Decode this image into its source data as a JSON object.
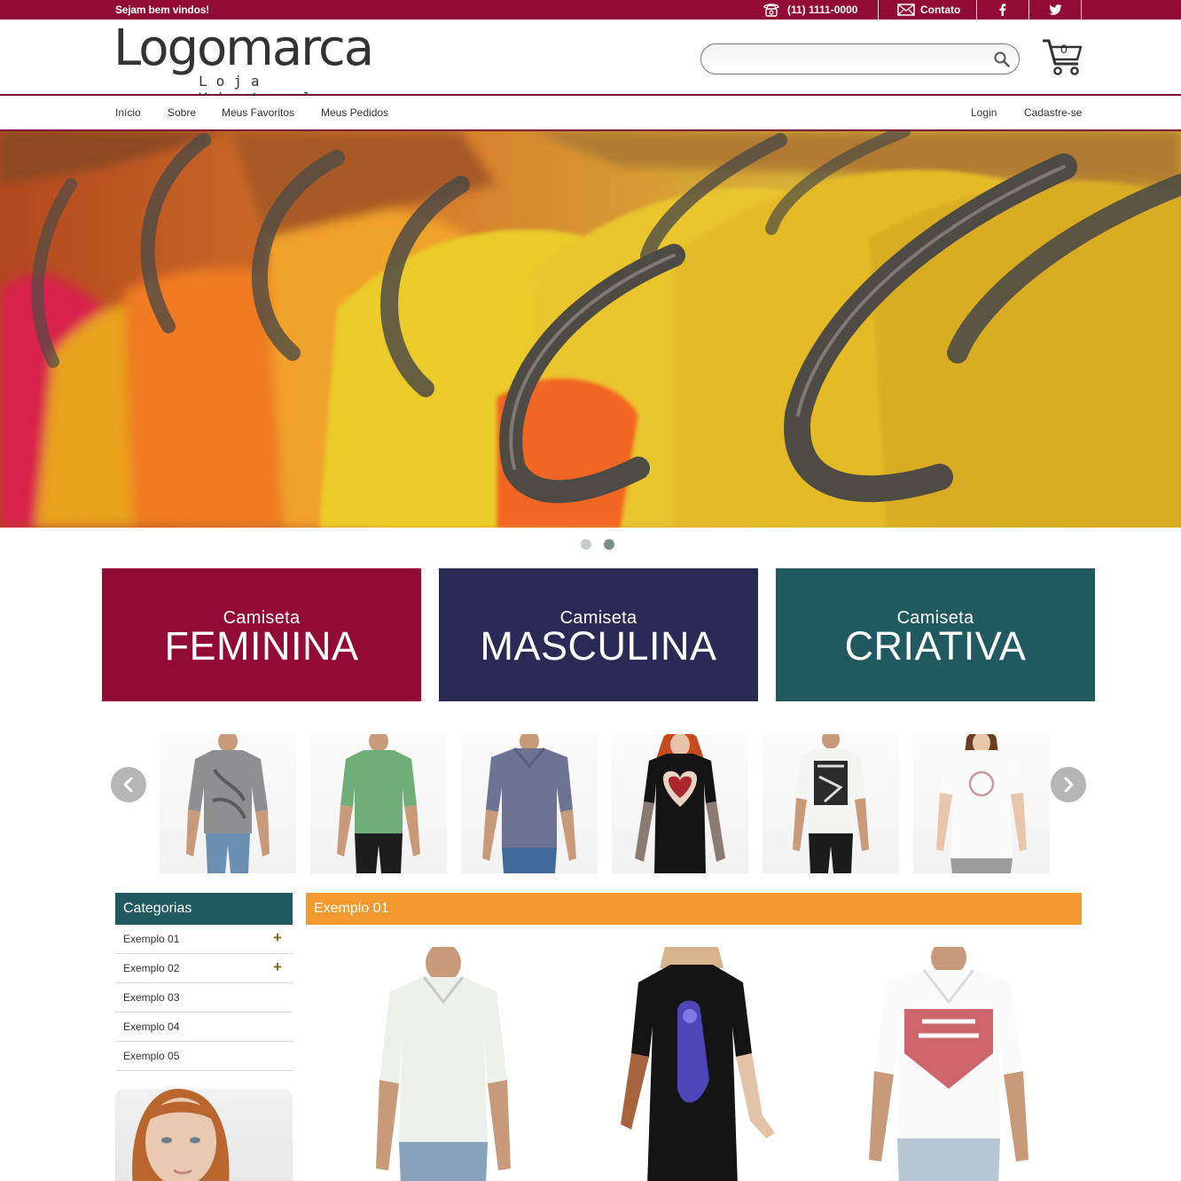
{
  "topbar": {
    "welcome": "Sejam bem vindos!",
    "phone": "(11) 1111-0000",
    "contact_label": "Contato",
    "social": [
      "facebook-icon",
      "twitter-icon"
    ]
  },
  "header": {
    "logo_main": "Logomarca",
    "logo_sub": "Loja Virtual",
    "search_placeholder": "",
    "cart_count": "0"
  },
  "nav": {
    "left": [
      "Início",
      "Sobre",
      "Meus Favoritos",
      "Meus Pedidos"
    ],
    "right": [
      "Login",
      "Cadastre-se"
    ]
  },
  "slider": {
    "slides": 2,
    "active_index": 1
  },
  "banners": [
    {
      "line1": "Camiseta",
      "line2": "FEMININA",
      "color": "#920b35"
    },
    {
      "line1": "Camiseta",
      "line2": "MASCULINA",
      "color": "#292a55"
    },
    {
      "line1": "Camiseta",
      "line2": "CRIATIVA",
      "color": "#215960"
    }
  ],
  "carousel": {
    "prev_icon": "chevron-left-icon",
    "next_icon": "chevron-right-icon"
  },
  "sidebar": {
    "title": "Categorias",
    "items": [
      {
        "label": "Exemplo 01",
        "expandable": true
      },
      {
        "label": "Exemplo 02",
        "expandable": true
      },
      {
        "label": "Exemplo 03",
        "expandable": false
      },
      {
        "label": "Exemplo 04",
        "expandable": false
      },
      {
        "label": "Exemplo 05",
        "expandable": false
      }
    ]
  },
  "section": {
    "title": "Exemplo 01"
  },
  "colors": {
    "brand": "#920b35",
    "navy": "#292a55",
    "teal": "#215960",
    "orange": "#f29a2e"
  }
}
